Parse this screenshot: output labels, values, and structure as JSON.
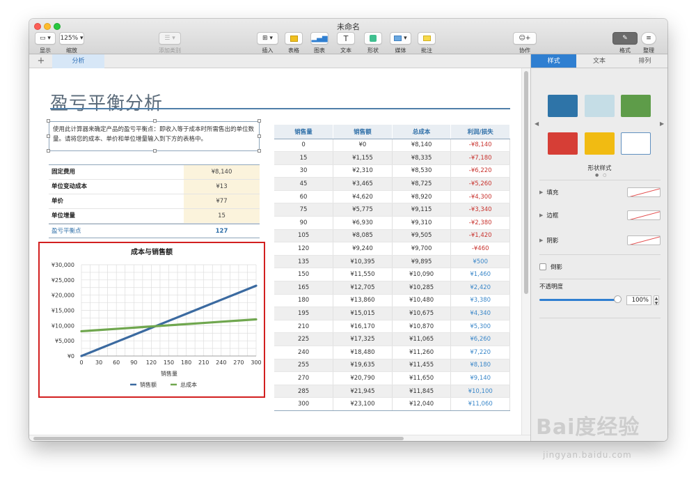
{
  "window": {
    "title": "未命名"
  },
  "toolbar": {
    "view_label": "显示",
    "zoom_value": "125%",
    "zoom_label": "缩放",
    "category_label": "添加类别",
    "insert_label": "插入",
    "table_label": "表格",
    "chart_label": "图表",
    "text_label": "文本",
    "shape_label": "形状",
    "media_label": "媒体",
    "comment_label": "批注",
    "collab_label": "协作",
    "format_label": "格式",
    "organize_label": "整理"
  },
  "sheets": {
    "add": "+",
    "active": "分析"
  },
  "document": {
    "title": "盈亏平衡分析",
    "description": "使用此计算器来确定产品的盈亏平衡点：即收入等于成本时所需售出的单位数量。请将您的成本、单价和单位增量输入到下方的表格中。",
    "inputs": [
      {
        "label": "固定费用",
        "value": "¥8,140"
      },
      {
        "label": "单位变动成本",
        "value": "¥13"
      },
      {
        "label": "单价",
        "value": "¥77"
      },
      {
        "label": "单位增量",
        "value": "15"
      }
    ],
    "result": {
      "label": "盈亏平衡点",
      "value": "127"
    }
  },
  "sales_table": {
    "headers": [
      "销售量",
      "销售额",
      "总成本",
      "利润/损失"
    ],
    "rows": [
      [
        "0",
        "¥0",
        "¥8,140",
        "-¥8,140"
      ],
      [
        "15",
        "¥1,155",
        "¥8,335",
        "-¥7,180"
      ],
      [
        "30",
        "¥2,310",
        "¥8,530",
        "-¥6,220"
      ],
      [
        "45",
        "¥3,465",
        "¥8,725",
        "-¥5,260"
      ],
      [
        "60",
        "¥4,620",
        "¥8,920",
        "-¥4,300"
      ],
      [
        "75",
        "¥5,775",
        "¥9,115",
        "-¥3,340"
      ],
      [
        "90",
        "¥6,930",
        "¥9,310",
        "-¥2,380"
      ],
      [
        "105",
        "¥8,085",
        "¥9,505",
        "-¥1,420"
      ],
      [
        "120",
        "¥9,240",
        "¥9,700",
        "-¥460"
      ],
      [
        "135",
        "¥10,395",
        "¥9,895",
        "¥500"
      ],
      [
        "150",
        "¥11,550",
        "¥10,090",
        "¥1,460"
      ],
      [
        "165",
        "¥12,705",
        "¥10,285",
        "¥2,420"
      ],
      [
        "180",
        "¥13,860",
        "¥10,480",
        "¥3,380"
      ],
      [
        "195",
        "¥15,015",
        "¥10,675",
        "¥4,340"
      ],
      [
        "210",
        "¥16,170",
        "¥10,870",
        "¥5,300"
      ],
      [
        "225",
        "¥17,325",
        "¥11,065",
        "¥6,260"
      ],
      [
        "240",
        "¥18,480",
        "¥11,260",
        "¥7,220"
      ],
      [
        "255",
        "¥19,635",
        "¥11,455",
        "¥8,180"
      ],
      [
        "270",
        "¥20,790",
        "¥11,650",
        "¥9,140"
      ],
      [
        "285",
        "¥21,945",
        "¥11,845",
        "¥10,100"
      ],
      [
        "300",
        "¥23,100",
        "¥12,040",
        "¥11,060"
      ]
    ]
  },
  "chart_data": {
    "type": "line",
    "title": "成本与销售额",
    "xlabel": "销售量",
    "ylabel": "",
    "x": [
      0,
      30,
      60,
      90,
      120,
      150,
      180,
      210,
      240,
      270,
      300
    ],
    "xlim": [
      0,
      300
    ],
    "ylim": [
      0,
      30000
    ],
    "y_ticks": [
      0,
      5000,
      10000,
      15000,
      20000,
      25000,
      30000
    ],
    "y_tick_labels": [
      "¥0",
      "¥5,000",
      "¥10,000",
      "¥15,000",
      "¥20,000",
      "¥25,000",
      "¥30,000"
    ],
    "x_tick_labels": [
      "0",
      "30",
      "60",
      "90",
      "120",
      "150",
      "180",
      "210",
      "240",
      "270",
      "300"
    ],
    "grid": true,
    "legend_position": "bottom",
    "series": [
      {
        "name": "销售额",
        "color": "#3b6aa0",
        "values": [
          0,
          2310,
          4620,
          6930,
          9240,
          11550,
          13860,
          16170,
          18480,
          20790,
          23100
        ]
      },
      {
        "name": "总成本",
        "color": "#70a74f",
        "values": [
          8140,
          8530,
          8920,
          9310,
          9700,
          10090,
          10480,
          10870,
          11260,
          11650,
          12040
        ]
      }
    ]
  },
  "inspector": {
    "tabs": [
      "样式",
      "文本",
      "排列"
    ],
    "style_caption": "形状样式",
    "swatch_colors": [
      "#2e74a8",
      "#c5dde6",
      "#5e9c49",
      "#d63e36",
      "#f1bb12",
      "#ffffff"
    ],
    "fill_label": "填充",
    "border_label": "边框",
    "shadow_label": "阴影",
    "reflection_label": "倒影",
    "opacity_label": "不透明度",
    "opacity_value": "100%"
  },
  "watermark": {
    "line1": "Bai度经验",
    "line2": "jingyan.baidu.com"
  }
}
